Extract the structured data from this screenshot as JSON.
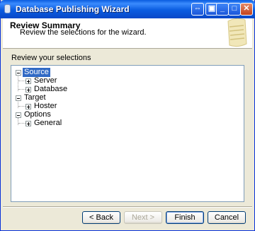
{
  "window": {
    "title": "Database Publishing Wizard"
  },
  "header": {
    "title": "Review Summary",
    "subtitle": "Review the selections for the wizard."
  },
  "review_label": "Review your selections",
  "tree": {
    "source": {
      "label": "Source",
      "children": [
        "Server",
        "Database"
      ]
    },
    "target": {
      "label": "Target",
      "children": [
        "Hoster"
      ]
    },
    "options": {
      "label": "Options",
      "children": [
        "General"
      ]
    }
  },
  "buttons": {
    "back": "< Back",
    "next": "Next >",
    "finish": "Finish",
    "cancel": "Cancel"
  },
  "colors": {
    "title_bar": "#0a5ce0",
    "selection": "#316ac5",
    "dialog_bg": "#ece9d8"
  },
  "icons": {
    "app": "database-icon",
    "titlebar_buttons": [
      "help-icon",
      "restore-icon",
      "minimize-icon",
      "maximize-icon",
      "close-icon"
    ]
  }
}
